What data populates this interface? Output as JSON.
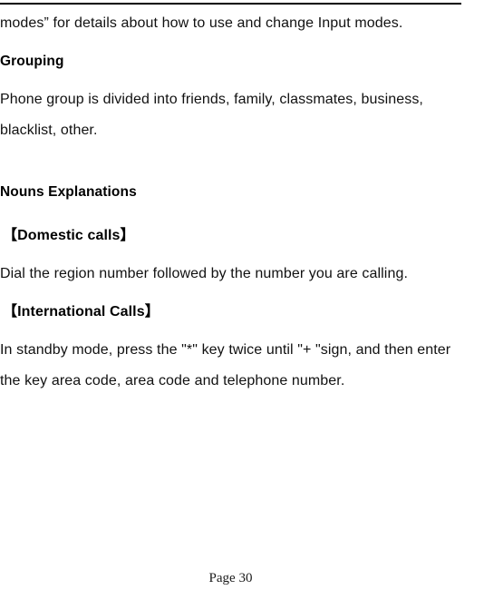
{
  "document": {
    "page_label": "Page 30",
    "header_rule": true,
    "blocks": [
      {
        "id": "intro-continuation",
        "type": "paragraph",
        "align": "justify",
        "text": "modes” for details about how to use and change Input modes."
      },
      {
        "id": "grouping-heading",
        "type": "heading",
        "text": "Grouping"
      },
      {
        "id": "grouping-paragraph",
        "type": "paragraph",
        "align": "left",
        "text": "Phone group is divided into friends, family, classmates, business, blacklist, other."
      },
      {
        "id": "nouns-explanations-heading",
        "type": "heading",
        "text": "Nouns Explanations"
      },
      {
        "id": "domestic-calls-heading",
        "type": "heading-bracketed",
        "text": "【Domestic calls】"
      },
      {
        "id": "domestic-calls-paragraph",
        "type": "paragraph",
        "align": "justify",
        "text": "Dial the region number followed by the number you are calling."
      },
      {
        "id": "international-calls-heading",
        "type": "heading-bracketed",
        "text": "【International Calls】"
      },
      {
        "id": "international-calls-paragraph",
        "type": "paragraph",
        "align": "left",
        "text": "In standby mode, press the \"*\" key twice until \"+ \"sign, and then enter the key area code, area code and telephone number."
      }
    ]
  },
  "colors": {
    "page_background": "#ffffff",
    "text": "#111111",
    "rule": "#000000",
    "footer_text": "#1a1a1a"
  }
}
